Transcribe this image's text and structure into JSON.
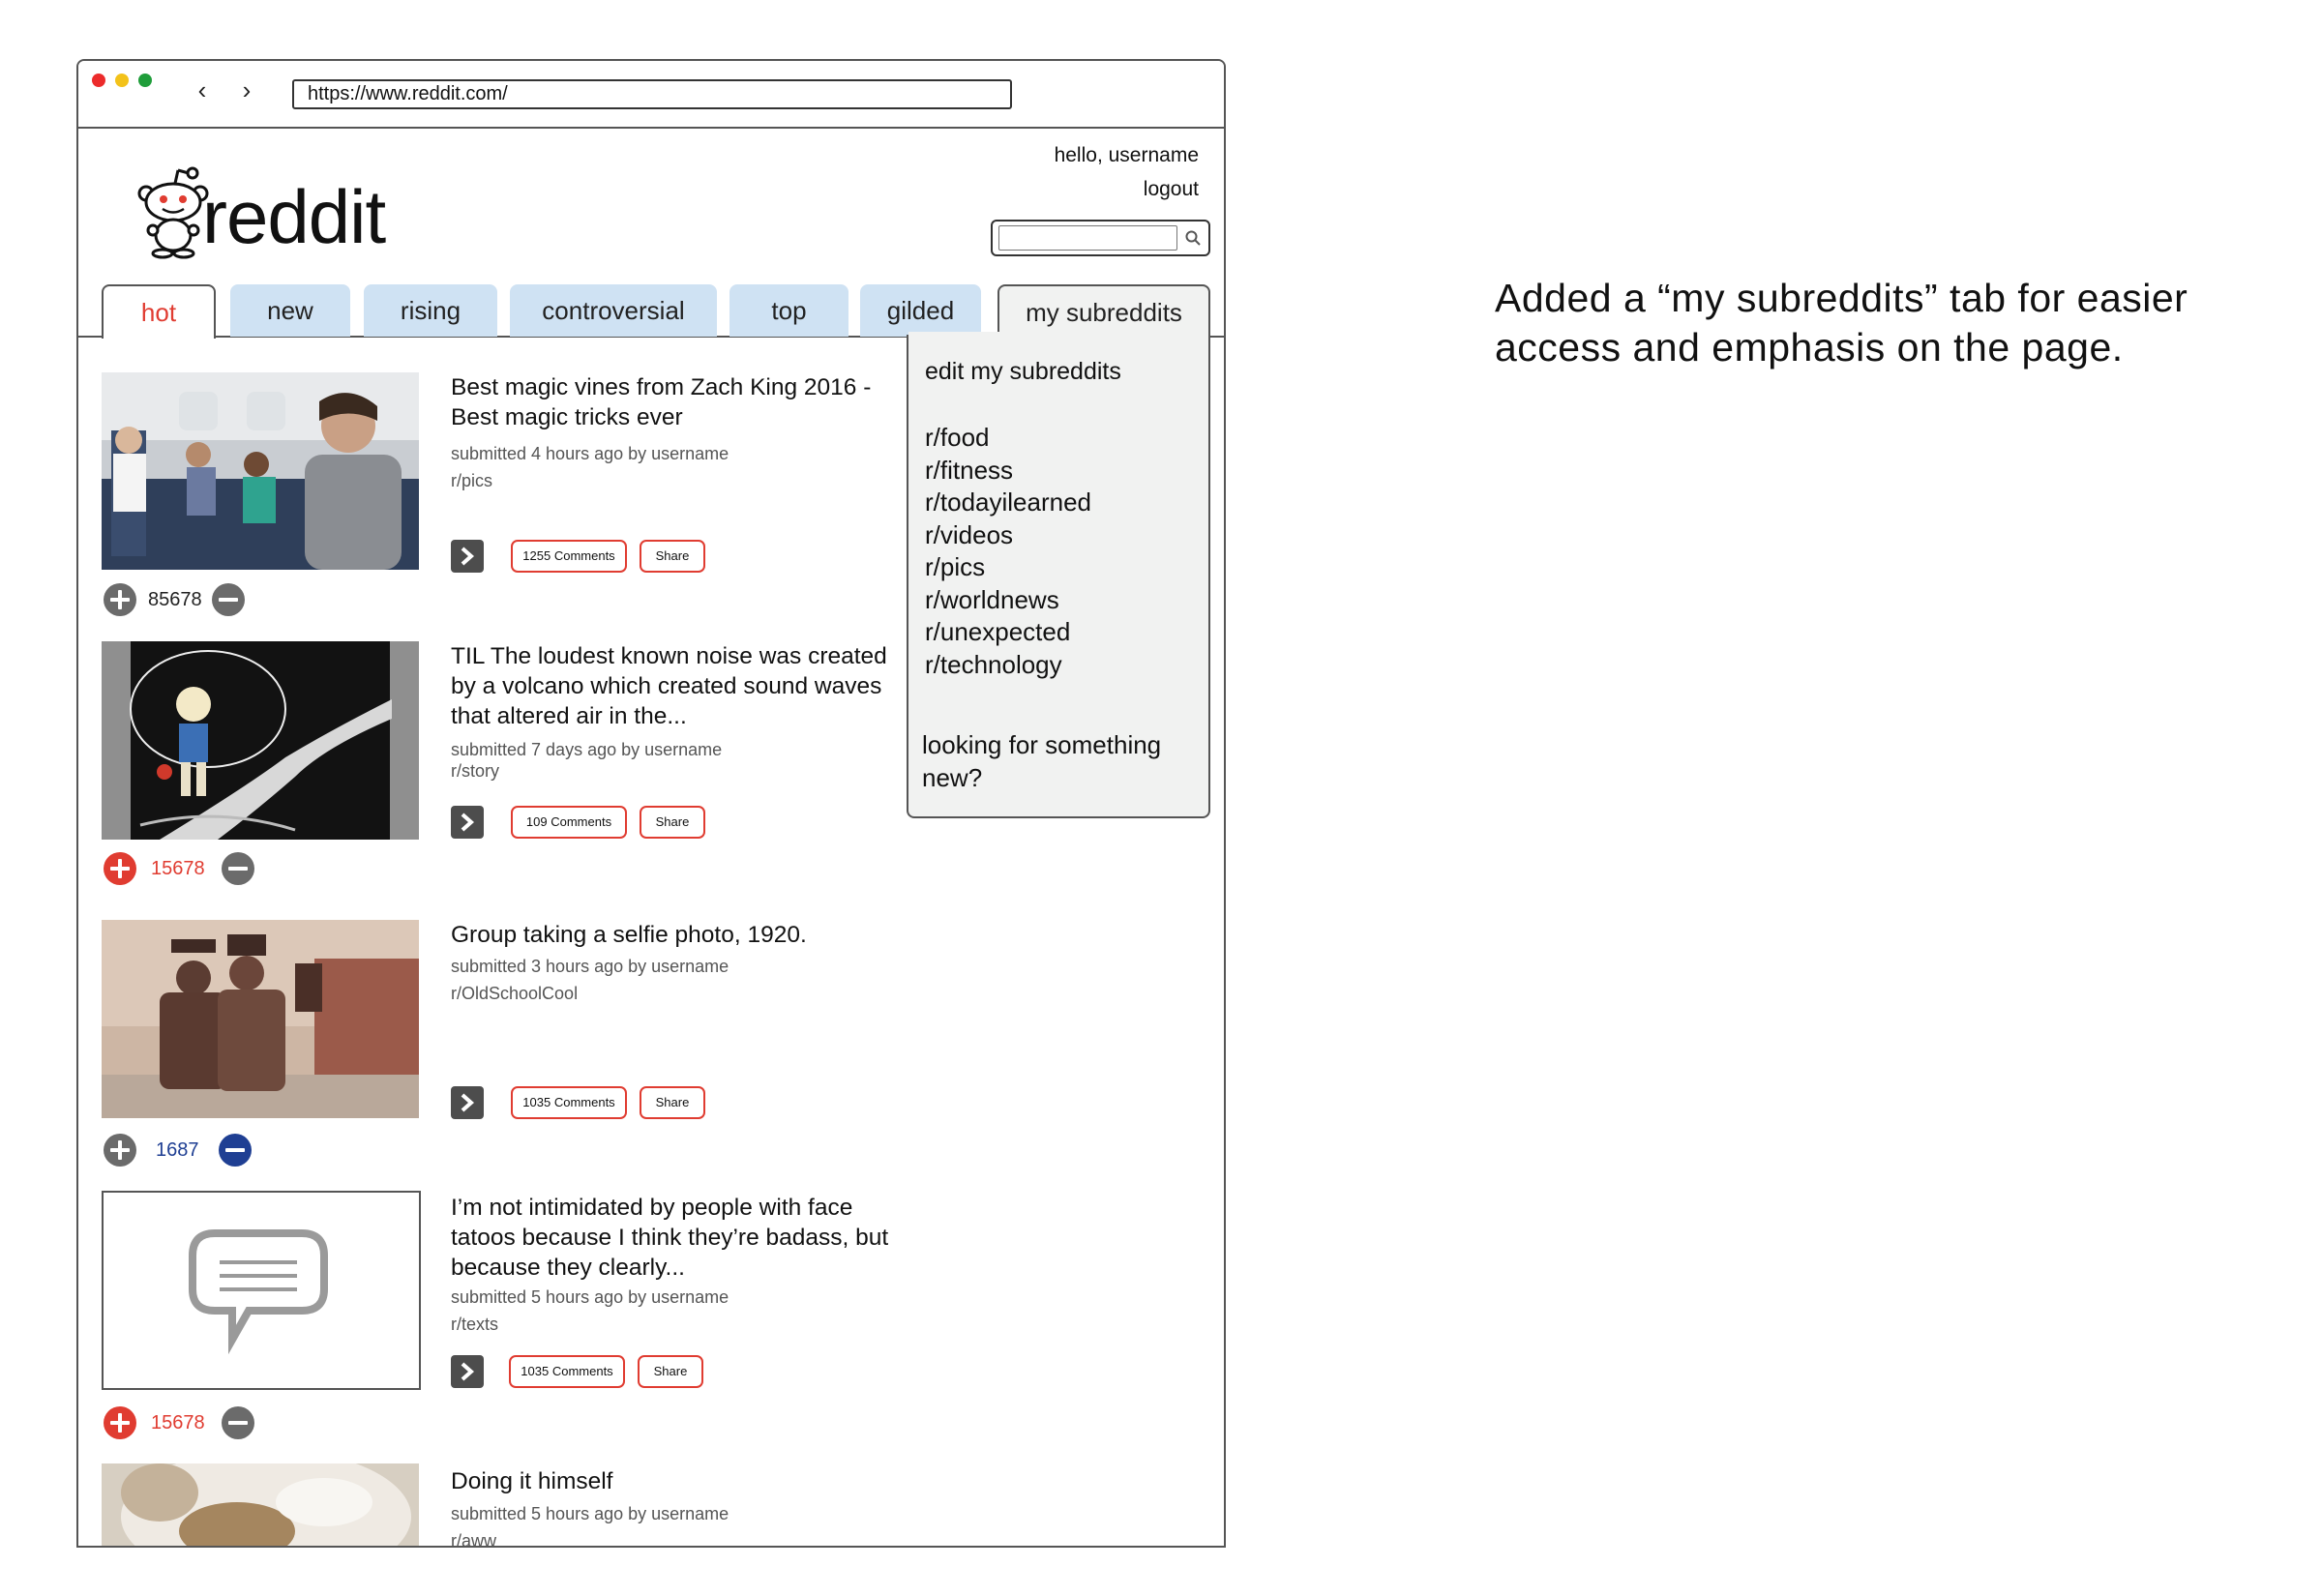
{
  "browser": {
    "url": "https://www.reddit.com/",
    "back_icon": "‹",
    "forward_icon": "›"
  },
  "header": {
    "logo_text": "reddit",
    "greeting": "hello, username",
    "logout": "logout",
    "search_placeholder": ""
  },
  "tabs": [
    {
      "label": "hot"
    },
    {
      "label": "new"
    },
    {
      "label": "rising"
    },
    {
      "label": "controversial"
    },
    {
      "label": "top"
    },
    {
      "label": "gilded"
    },
    {
      "label": "my subreddits"
    }
  ],
  "dropdown": {
    "edit": "edit my subreddits",
    "subreddits": [
      "r/food",
      "r/fitness",
      "r/todayilearned",
      "r/videos",
      "r/pics",
      "r/worldnews",
      "r/unexpected",
      "r/technology"
    ],
    "discover": "looking for something new?"
  },
  "posts": [
    {
      "title": "Best magic vines from Zach King 2016 -Best magic tricks ever",
      "submitted": "submitted 4 hours ago by username",
      "subreddit": "r/pics",
      "comments": "1255 Comments",
      "share": "Share",
      "score": "85678",
      "vote_state": "none"
    },
    {
      "title": "TIL The loudest known noise was created by a volcano which created sound waves that altered air in the...",
      "submitted": "submitted 7 days ago by username",
      "subreddit": "r/story",
      "comments": "109 Comments",
      "share": "Share",
      "score": "15678",
      "vote_state": "up"
    },
    {
      "title": "Group taking a selfie photo, 1920.",
      "submitted": "submitted 3 hours ago by username",
      "subreddit": "r/OldSchoolCool",
      "comments": "1035 Comments",
      "share": "Share",
      "score": "1687",
      "vote_state": "down"
    },
    {
      "title": "I’m not intimidated by people with face tatoos because I think they’re badass, but because they clearly...",
      "submitted": "submitted 5  hours ago by username",
      "subreddit": "r/texts",
      "comments": "1035 Comments",
      "share": "Share",
      "score": "15678",
      "vote_state": "up"
    },
    {
      "title": "Doing it himself",
      "submitted": "submitted 5 hours ago by username",
      "subreddit": "r/aww"
    }
  ],
  "colors": {
    "accent_red": "#e03c31",
    "tab_blue": "#cfe2f3",
    "downvote_blue": "#1f3f93",
    "dropdown_bg": "#f1f2f1"
  },
  "annotation": "Added a “my subreddits” tab for easier access and emphasis on the page."
}
